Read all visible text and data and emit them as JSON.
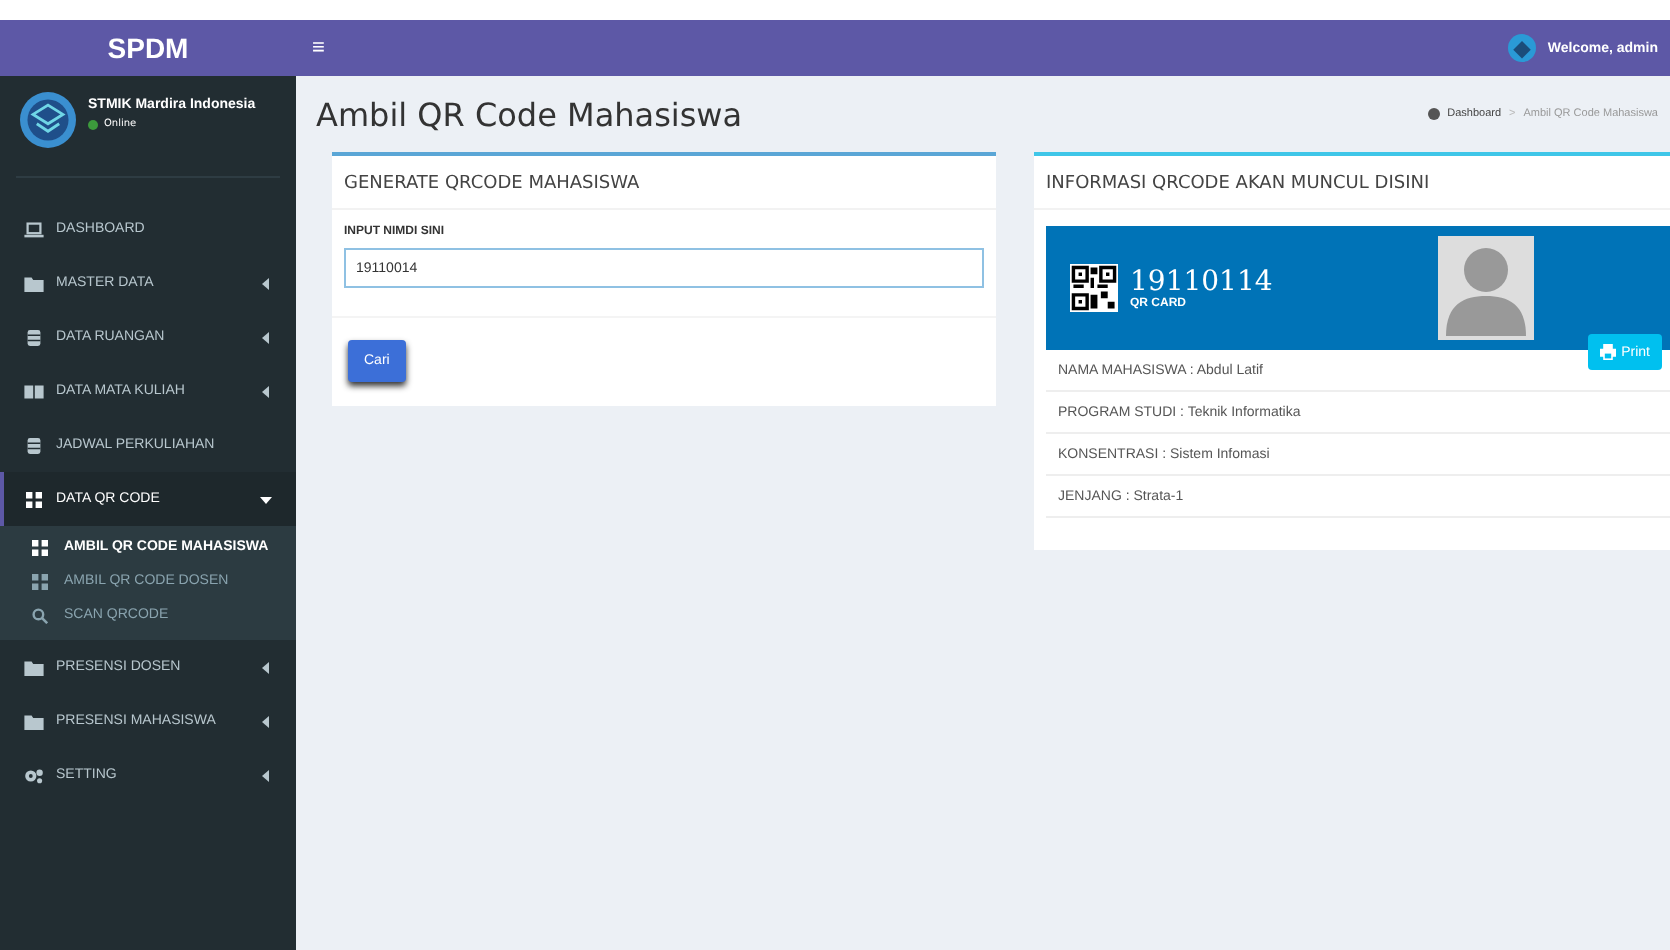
{
  "brand": "SPDM",
  "topbar": {
    "menu_glyph": "≡",
    "welcome": "Welcome, admin"
  },
  "user": {
    "name": "STMIK Mardira Indonesia",
    "status": "Online"
  },
  "menu": [
    {
      "label": "DASHBOARD",
      "selected": false
    },
    {
      "label": "MASTER DATA",
      "expanded": false,
      "selected": false
    },
    {
      "label": "DATA RUANGAN",
      "expanded": false,
      "selected": false
    },
    {
      "label": "DATA MATA KULIAH",
      "expanded": false,
      "selected": false
    },
    {
      "label": "JADWAL PERKULIAHAN",
      "selected": false
    },
    {
      "label": "DATA QR CODE",
      "expanded": true,
      "selected": true,
      "children": [
        {
          "label": "AMBIL QR CODE MAHASISWA",
          "selected": true
        },
        {
          "label": "AMBIL QR CODE DOSEN",
          "selected": false
        },
        {
          "label": "SCAN QRCODE",
          "selected": false
        }
      ]
    },
    {
      "label": "PRESENSI DOSEN",
      "expanded": false,
      "selected": false
    },
    {
      "label": "PRESENSI MAHASISWA",
      "expanded": false,
      "selected": false
    },
    {
      "label": "SETTING",
      "expanded": false,
      "selected": false
    }
  ],
  "page_title": "Ambil QR Code Mahasiswa",
  "breadcrumb": {
    "items": [
      "Dashboard",
      "Ambil QR Code Mahasiswa"
    ],
    "separator": ">"
  },
  "generate_box": {
    "title": "GENERATE QRCODE MAHASISWA",
    "field_label": "INPUT NIMDI SINI",
    "field_value": "19110014",
    "button": "Cari"
  },
  "info_box": {
    "title": "INFORMASI QRCODE AKAN MUNCUL DISINI",
    "card_number": "19110114",
    "card_label": "QR CARD",
    "print": "Print",
    "rows": [
      "NAMA MAHASISWA : Abdul Latif",
      "PROGRAM STUDI : Teknik Informatika",
      "KONSENTRASI : Sistem Infomasi",
      "JENJANG : Strata-1"
    ]
  }
}
